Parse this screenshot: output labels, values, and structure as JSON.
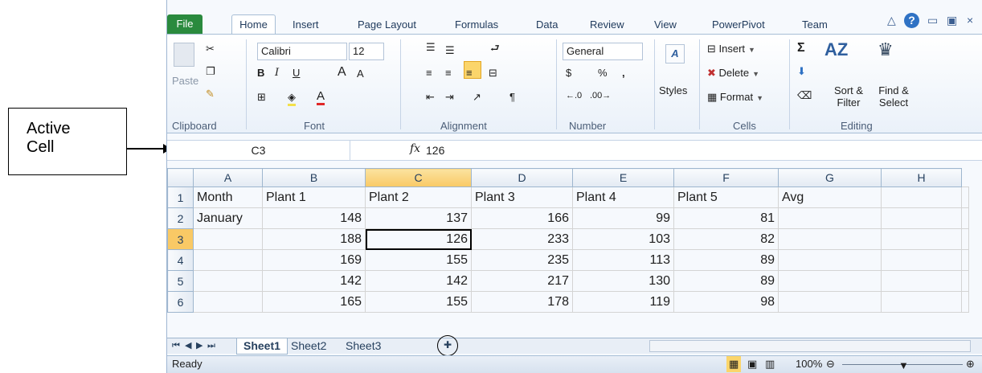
{
  "annotation": {
    "line1": "Active",
    "line2": "Cell"
  },
  "tabs": [
    "File",
    "Home",
    "Insert",
    "Page Layout",
    "Formulas",
    "Data",
    "Review",
    "View",
    "PowerPivot",
    "Team"
  ],
  "ribbon": {
    "paste": "Paste",
    "font_name": "Calibri",
    "font_size": "12",
    "number_format": "General",
    "styles": "Styles",
    "insert": "Insert",
    "delete": "Delete",
    "format": "Format",
    "sort_filter": "Sort & Filter",
    "find_select": "Find & Select",
    "groups": [
      "Clipboard",
      "Font",
      "Alignment",
      "Number",
      "Cells",
      "Editing"
    ]
  },
  "formula_bar": {
    "name_box": "C3",
    "fx": "fx",
    "value": "126"
  },
  "columns": [
    "A",
    "B",
    "C",
    "D",
    "E",
    "F",
    "G",
    "H"
  ],
  "rows": [
    {
      "n": "1",
      "cells": [
        "Month",
        "Plant 1",
        "Plant 2",
        "Plant 3",
        "Plant 4",
        "Plant 5",
        "Avg",
        ""
      ]
    },
    {
      "n": "2",
      "cells": [
        "January",
        "148",
        "137",
        "166",
        "99",
        "81",
        "",
        ""
      ]
    },
    {
      "n": "3",
      "cells": [
        "",
        "188",
        "126",
        "233",
        "103",
        "82",
        "",
        ""
      ]
    },
    {
      "n": "4",
      "cells": [
        "",
        "169",
        "155",
        "235",
        "113",
        "89",
        "",
        ""
      ]
    },
    {
      "n": "5",
      "cells": [
        "",
        "142",
        "142",
        "217",
        "130",
        "89",
        "",
        ""
      ]
    },
    {
      "n": "6",
      "cells": [
        "",
        "165",
        "155",
        "178",
        "119",
        "98",
        "",
        ""
      ]
    }
  ],
  "sheets": [
    "Sheet1",
    "Sheet2",
    "Sheet3"
  ],
  "status": {
    "ready": "Ready",
    "zoom": "100%"
  },
  "colors": {
    "file_tab": "#2a8a3e",
    "selected_header": "#f9c965",
    "accent": "#1e395b"
  }
}
